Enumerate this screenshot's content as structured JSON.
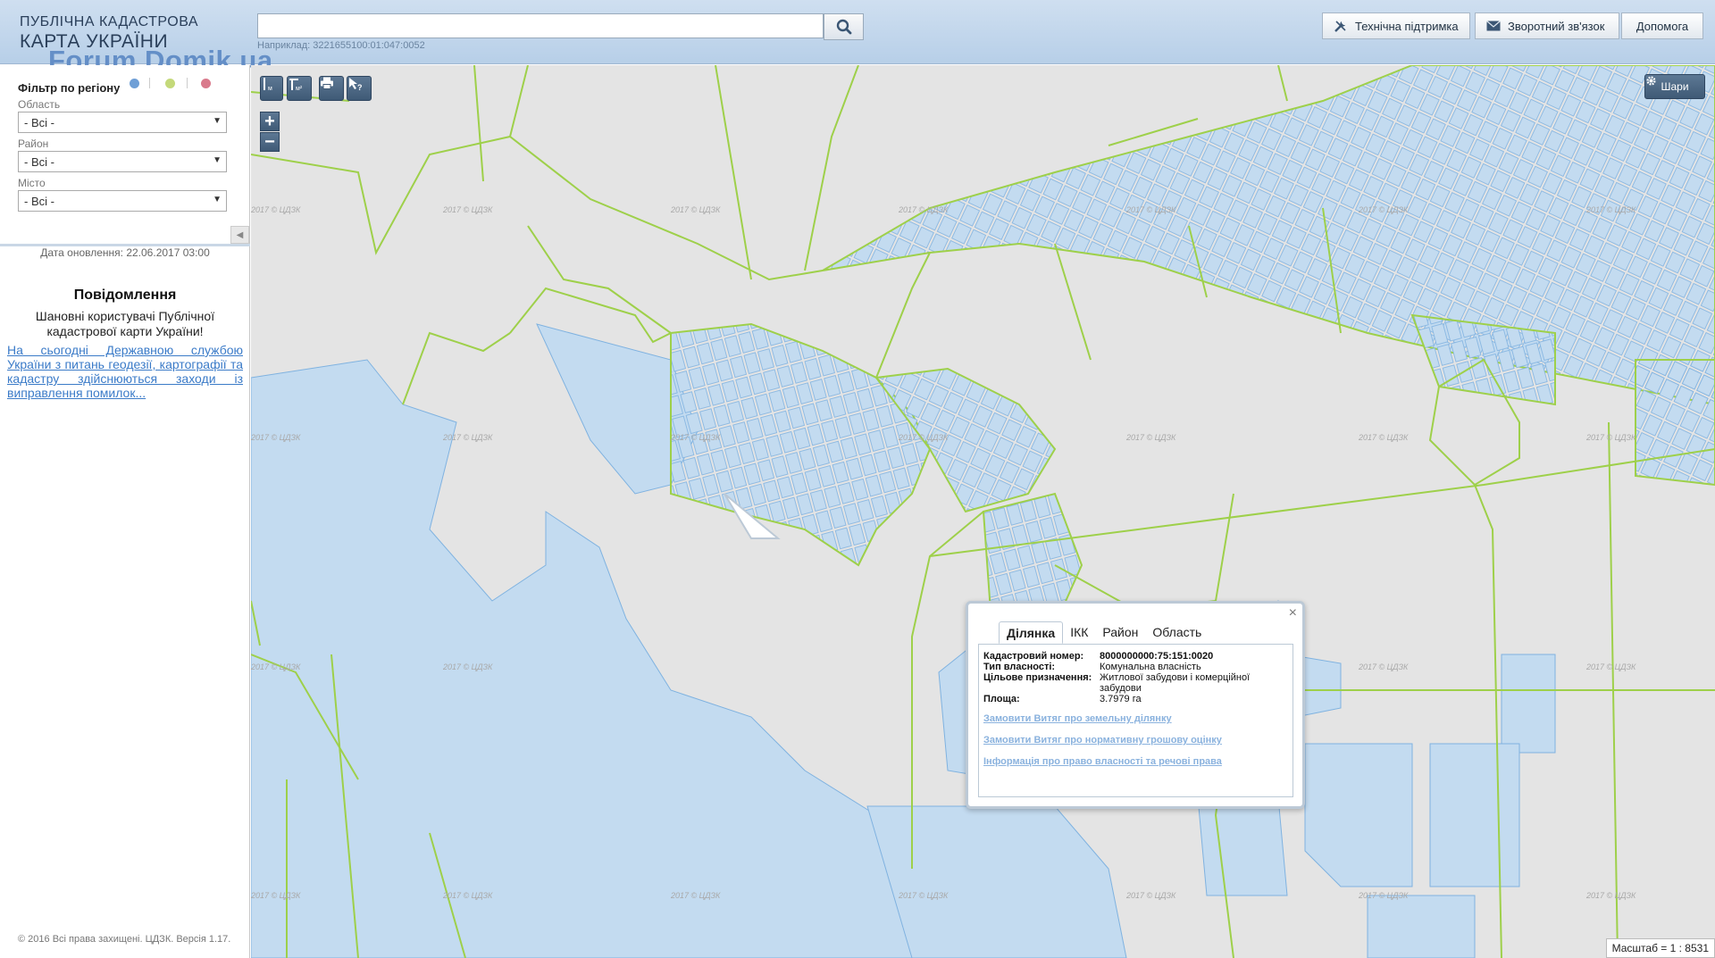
{
  "header": {
    "logo_line1": "ПУБЛІЧНА КАДАСТРОВА",
    "logo_line2": "КАРТА УКРАЇНИ",
    "watermark": "Forum.Domik.ua",
    "search_value": "",
    "search_hint": "Наприклад: 3221655100:01:047:0052",
    "buttons": {
      "support": "Технічна підтримка",
      "feedback": "Зворотний зв'язок",
      "help": "Допомога"
    }
  },
  "sidebar": {
    "filter_title": "Фільтр по регіону",
    "filter_dots": [
      "#6f9fd6",
      "#c4d97a",
      "#d97a8c"
    ],
    "region_label": "Область",
    "region_value": "- Всі -",
    "district_label": "Район",
    "district_value": "- Всі -",
    "city_label": "Місто",
    "city_value": "- Всі -",
    "update_date": "Дата оновлення: 22.06.2017 03:00",
    "notice_title": "Повідомлення",
    "notice_body": "Шановні користувачі Публічної кадастрової карти України!",
    "notice_link": "На сьогодні Державною службою України з питань геодезії, картографії та кадастру здійснюються заходи із виправлення помилок...",
    "copyright": "© 2016 Всі права захищені. ЦДЗК. Версія 1.17."
  },
  "map": {
    "tools": [
      "ruler-icon",
      "area-icon",
      "print-icon",
      "info-cursor-icon"
    ],
    "zoom_in": "+",
    "zoom_out": "−",
    "layers_label": "Шари",
    "tile_watermark": "2017 © ЦДЗК",
    "scale": "Масштаб = 1 : 8531",
    "colors": {
      "parcel_fill": "#c3dbf0",
      "parcel_stroke": "#7fb2e0",
      "boundary": "#9ed04a",
      "background": "#e4e4e4"
    }
  },
  "popup": {
    "tabs": [
      "Ділянка",
      "ІКК",
      "Район",
      "Область"
    ],
    "active_tab": "Ділянка",
    "fields": {
      "cadastral_label": "Кадастровий номер:",
      "cadastral_value": "8000000000:75:151:0020",
      "ownership_label": "Тип власності:",
      "ownership_value": "Комунальна власність",
      "purpose_label": "Цільове призначення:",
      "purpose_value": "Житлової забудови і комерційної забудови",
      "area_label": "Площа:",
      "area_value": "3.7979 га"
    },
    "links": {
      "extract_land": "Замовити Витяг про земельну ділянку",
      "extract_valuation": "Замовити Витяг про нормативну грошову оцінку",
      "rights_info": "Інформація про право власності та речові права"
    },
    "close": "×"
  }
}
